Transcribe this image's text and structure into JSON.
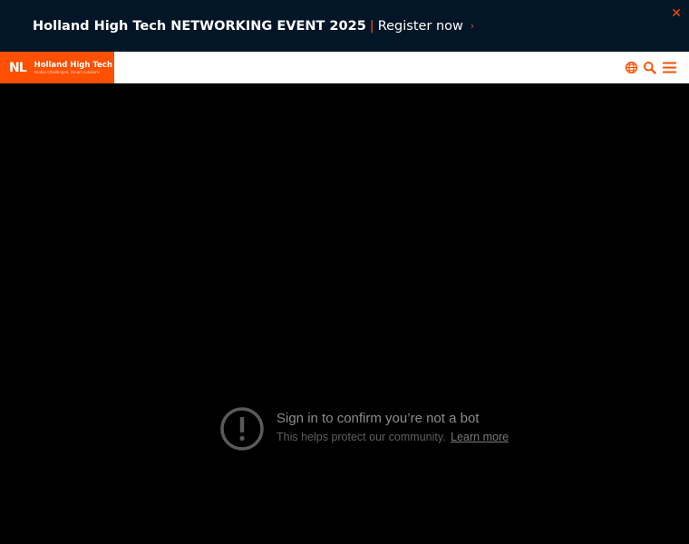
{
  "banner": {
    "title": "Holland High Tech NETWORKING EVENT 2025",
    "separator": "|",
    "cta": "Register now",
    "chevron": "›",
    "close_icon": "close-icon"
  },
  "header": {
    "logo_mark": "NL",
    "logo_name": "Holland High Tech",
    "logo_tagline": "Global Challenges, Smart Solutions",
    "icons": [
      "globe-icon",
      "search-icon",
      "hamburger-menu-icon"
    ]
  },
  "video": {
    "message_title": "Sign in to confirm you’re not a bot",
    "message_subtitle": "This helps protect our community.",
    "learn_more": "Learn more"
  },
  "colors": {
    "banner_bg": "#031627",
    "accent": "#ff4f00",
    "header_bg": "#ffffff",
    "video_bg": "#000000"
  }
}
